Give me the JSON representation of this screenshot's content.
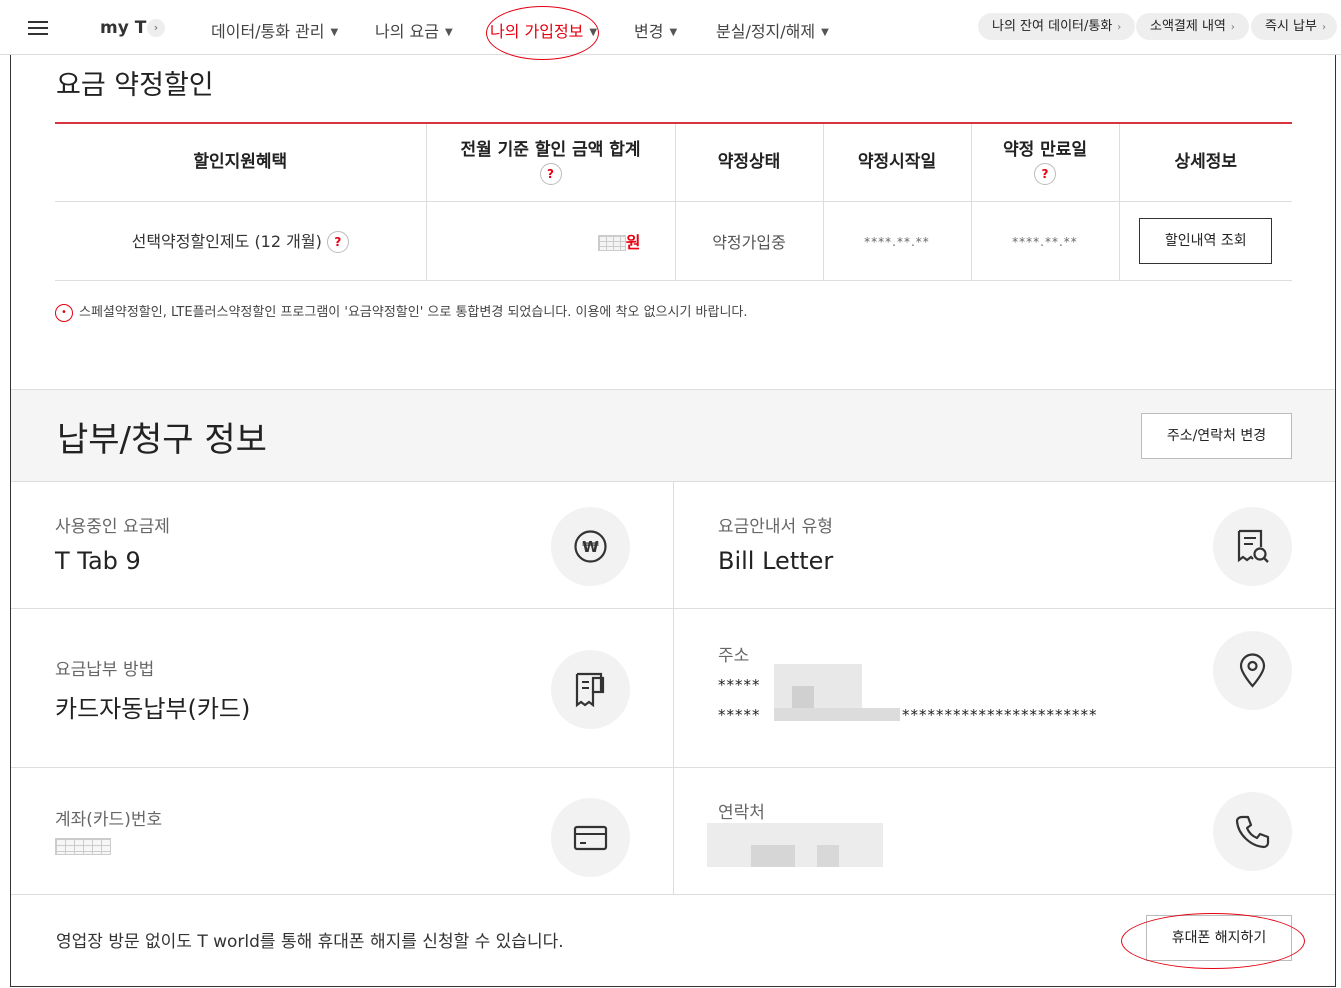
{
  "nav": {
    "brand": "my T",
    "items": [
      {
        "label": "데이터/통화 관리"
      },
      {
        "label": "나의 요금"
      },
      {
        "label": "나의 가입정보"
      },
      {
        "label": "변경"
      },
      {
        "label": "분실/정지/해제"
      }
    ],
    "pills": [
      {
        "label": "나의 잔여 데이터/통화"
      },
      {
        "label": "소액결제 내역"
      },
      {
        "label": "즉시 납부"
      }
    ],
    "accent_color": "#e60012"
  },
  "discount": {
    "title": "요금 약정할인",
    "headers": [
      "할인지원혜택",
      "전월 기준 할인 금액 합계",
      "약정상태",
      "약정시작일",
      "약정 만료일",
      "상세정보"
    ],
    "row": {
      "plan": "선택약정할인제도 (12 개월)",
      "amount_unit": "원",
      "status": "약정가입중",
      "start_date": "****.**.**",
      "end_date": "****.**.**",
      "detail_button": "할인내역 조회"
    },
    "notice": "스페셜약정할인, LTE플러스약정할인 프로그램이 '요금약정할인' 으로 통합변경 되었습니다. 이용에 착오 없으시기 바랍니다."
  },
  "payment": {
    "title": "납부/청구 정보",
    "change_button": "주소/연락처 변경",
    "plan_label": "사용중인 요금제",
    "plan_value": "T Tab 9",
    "bill_type_label": "요금안내서 유형",
    "bill_type_value": "Bill Letter",
    "method_label": "요금납부 방법",
    "method_value": "카드자동납부(카드)",
    "address_label": "주소",
    "address_line1": "*****",
    "address_line2": "*****",
    "address_line2_tail": "***********************",
    "account_label": "계좌(카드)번호",
    "contact_label": "연락처"
  },
  "footer": {
    "text": "영업장 방문 없이도 T world를 통해 휴대폰 해지를 신청할 수 있습니다.",
    "cancel_button": "휴대폰 해지하기"
  }
}
